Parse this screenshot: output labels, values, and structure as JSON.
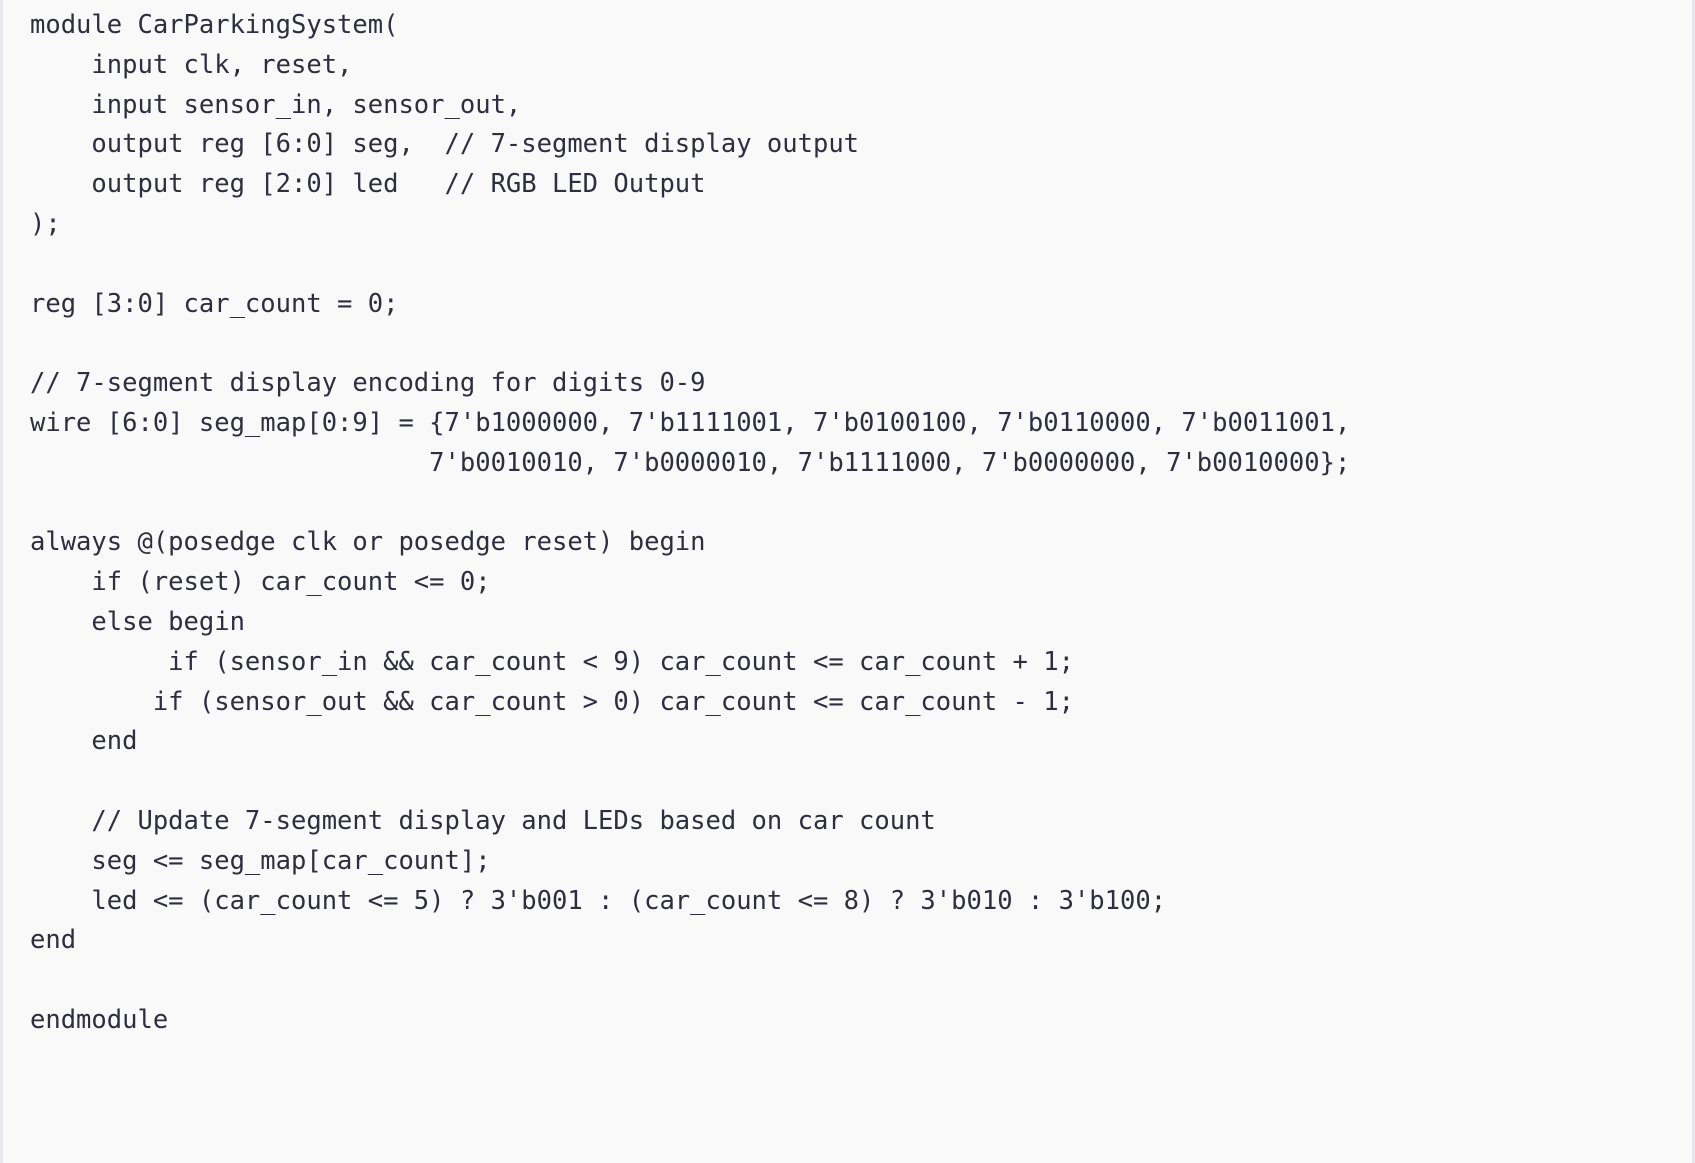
{
  "document": {
    "kind": "code-block",
    "language": "verilog",
    "module_name": "CarParkingSystem",
    "background_color": "#f9f9fa",
    "text_color": "#2e2e3e",
    "border_color": "#e9e9ec"
  },
  "code": {
    "lines": [
      "module CarParkingSystem(",
      "    input clk, reset,",
      "    input sensor_in, sensor_out,",
      "    output reg [6:0] seg,  // 7-segment display output",
      "    output reg [2:0] led   // RGB LED Output",
      ");",
      "",
      "reg [3:0] car_count = 0;",
      "",
      "// 7-segment display encoding for digits 0-9",
      "wire [6:0] seg_map[0:9] = {7'b1000000, 7'b1111001, 7'b0100100, 7'b0110000, 7'b0011001,",
      "                          7'b0010010, 7'b0000010, 7'b1111000, 7'b0000000, 7'b0010000};",
      "",
      "always @(posedge clk or posedge reset) begin",
      "    if (reset) car_count <= 0;",
      "    else begin",
      "         if (sensor_in && car_count < 9) car_count <= car_count + 1;",
      "        if (sensor_out && car_count > 0) car_count <= car_count - 1;",
      "    end",
      "",
      "    // Update 7-segment display and LEDs based on car count",
      "    seg <= seg_map[car_count];",
      "    led <= (car_count <= 5) ? 3'b001 : (car_count <= 8) ? 3'b010 : 3'b100;",
      "end",
      "",
      "endmodule"
    ]
  }
}
